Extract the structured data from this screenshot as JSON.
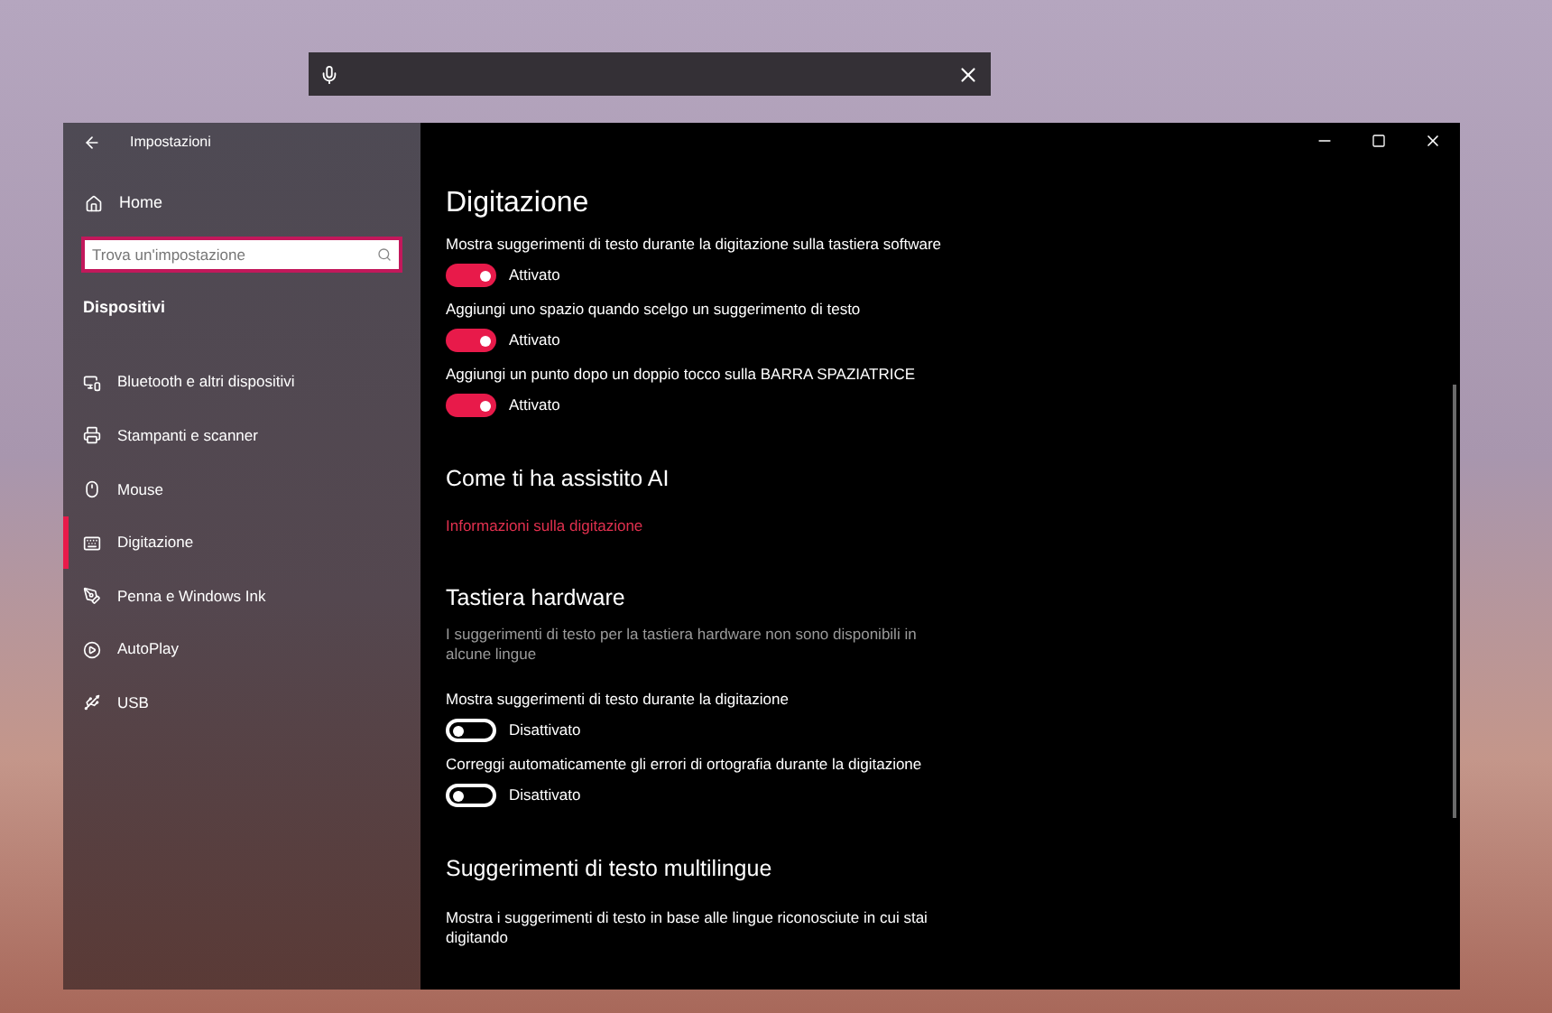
{
  "window": {
    "title": "Impostazioni"
  },
  "sidebar": {
    "home": "Home",
    "search": {
      "placeholder": "Trova un'impostazione"
    },
    "section": "Dispositivi",
    "items": [
      {
        "label": "Bluetooth e altri dispositivi",
        "selected": false
      },
      {
        "label": "Stampanti e scanner",
        "selected": false
      },
      {
        "label": "Mouse",
        "selected": false
      },
      {
        "label": "Digitazione",
        "selected": true
      },
      {
        "label": "Penna e Windows Ink",
        "selected": false
      },
      {
        "label": "AutoPlay",
        "selected": false
      },
      {
        "label": "USB",
        "selected": false
      }
    ]
  },
  "content": {
    "title": "Digitazione",
    "sections": [
      {
        "items": [
          {
            "kind": "toggle",
            "label": "Mostra suggerimenti di testo durante la digitazione sulla tastiera software",
            "on": true,
            "state": "Attivato"
          },
          {
            "kind": "toggle",
            "label": "Aggiungi uno spazio quando scelgo un suggerimento di testo",
            "on": true,
            "state": "Attivato"
          },
          {
            "kind": "toggle",
            "label": "Aggiungi un punto dopo un doppio tocco sulla BARRA SPAZIATRICE",
            "on": true,
            "state": "Attivato"
          }
        ]
      },
      {
        "heading": "Come ti ha assistito AI",
        "items": [
          {
            "kind": "link",
            "label": "Informazioni sulla digitazione"
          }
        ]
      },
      {
        "heading": "Tastiera hardware",
        "items": [
          {
            "kind": "note",
            "label": "I suggerimenti di testo per la tastiera hardware non sono disponibili in alcune lingue"
          },
          {
            "kind": "toggle",
            "label": "Mostra suggerimenti di testo durante la digitazione",
            "on": false,
            "state": "Disattivato"
          },
          {
            "kind": "toggle",
            "label": "Correggi automaticamente gli errori di ortografia durante la digitazione",
            "on": false,
            "state": "Disattivato"
          }
        ]
      },
      {
        "heading": "Suggerimenti di testo multilingue",
        "items": [
          {
            "kind": "text",
            "label": "Mostra i suggerimenti di testo in base alle lingue riconosciute in cui stai digitando"
          }
        ]
      }
    ]
  }
}
